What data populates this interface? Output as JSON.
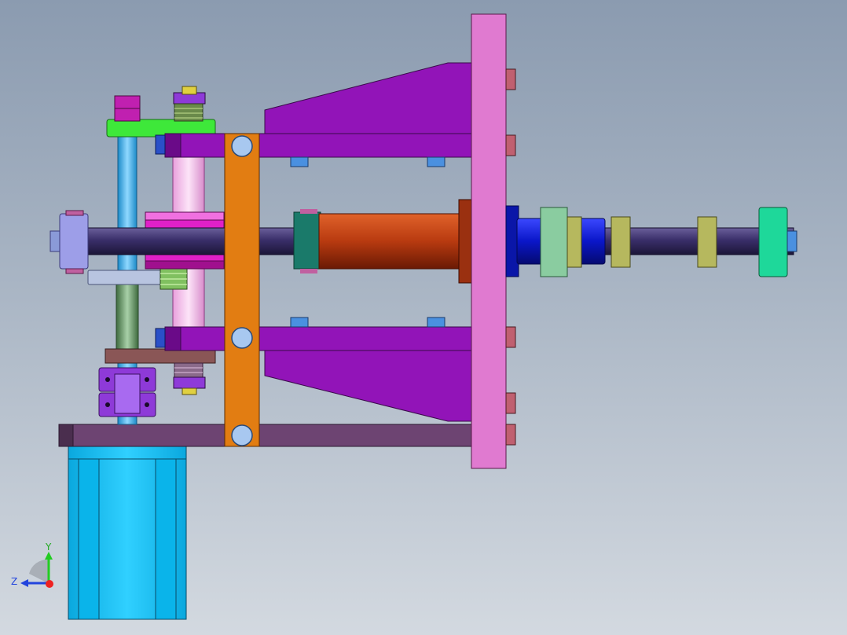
{
  "viewport": {
    "name": "3d-cad-viewport",
    "background_top": "#8b9bb0",
    "background_bottom": "#d3d9e0"
  },
  "triad": {
    "y_label": "Y",
    "z_label": "Z",
    "y_color": "#22cc22",
    "z_color": "#2244dd",
    "x_color": "#ee2222"
  },
  "colors": {
    "mount_plate": "#e07ad0",
    "bracket": "#9214b8",
    "base_plate": "#6d4472",
    "vertical_bar": "#e27d12",
    "motor": "#14c0f4",
    "shaft": "#3a2f6a",
    "cylinder": "#b83a10",
    "cylinder_cap": "#0a16c8",
    "end_nut": "#1ed89a",
    "hex_nut": "#b6b85e",
    "bolt": "#4a90e0",
    "small_bolt": "#c06070",
    "green_plate": "#3ee83a",
    "brown_plate": "#8a5656",
    "coupling": "#8e3ad8",
    "guide_rod": "#3aa8e0",
    "lavender_block": "#9d9ee8",
    "pink_pillar": "#f0b4e6",
    "magenta_block": "#e020c8"
  }
}
